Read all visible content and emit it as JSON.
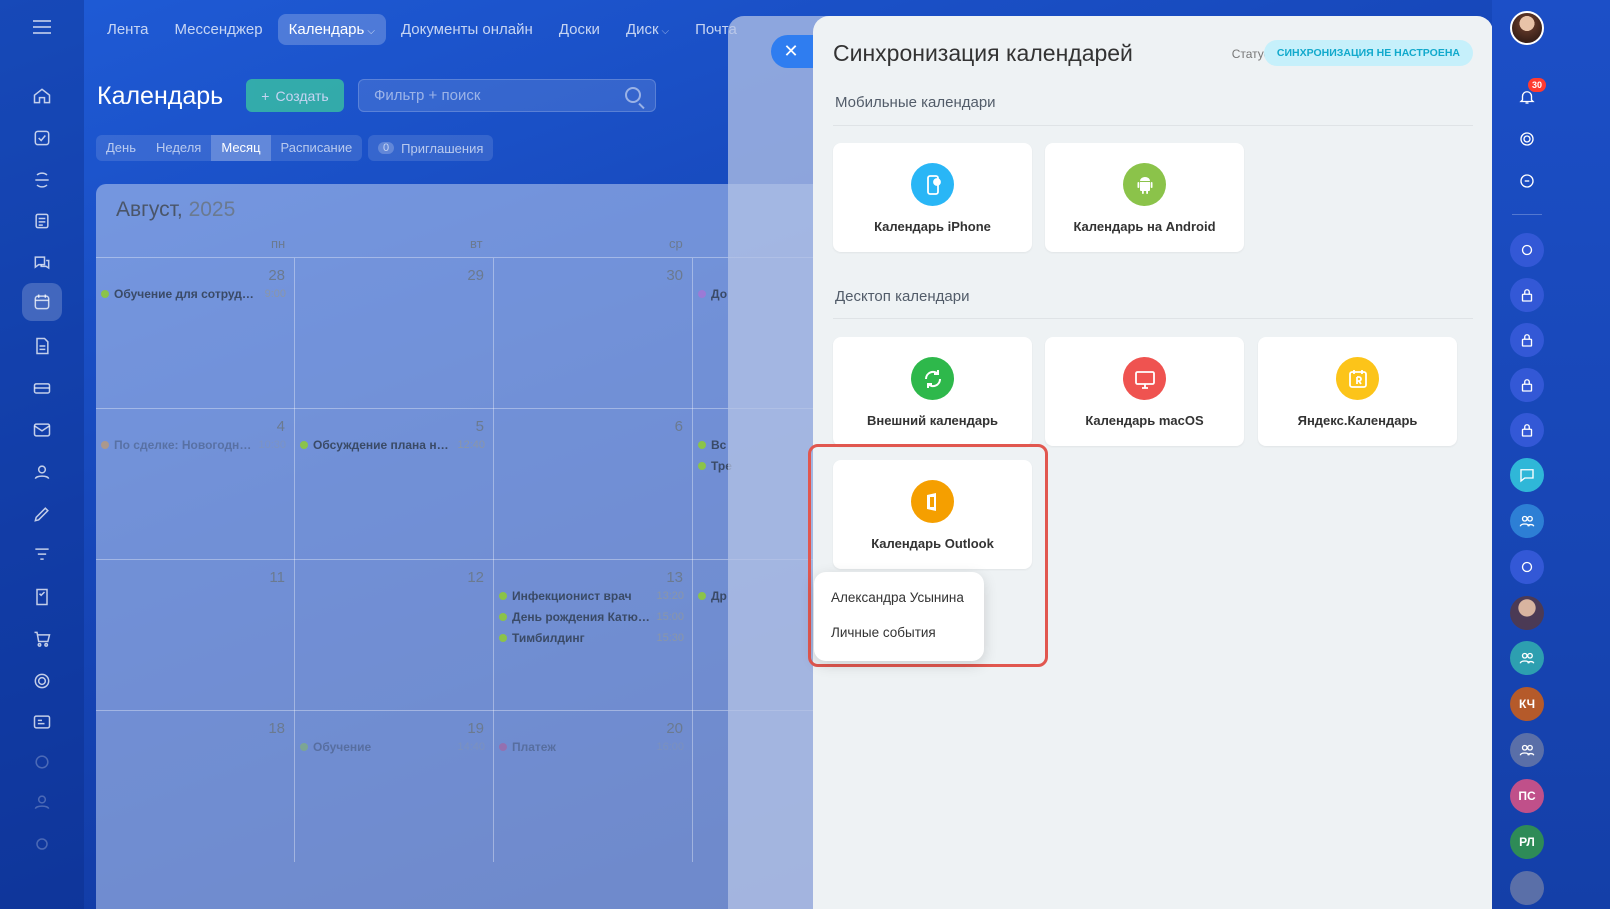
{
  "top_nav": {
    "items": [
      {
        "label": "Лента",
        "caret": false,
        "active": false
      },
      {
        "label": "Мессенджер",
        "caret": false,
        "active": false
      },
      {
        "label": "Календарь",
        "caret": true,
        "active": true
      },
      {
        "label": "Документы онлайн",
        "caret": false,
        "active": false
      },
      {
        "label": "Доски",
        "caret": false,
        "active": false
      },
      {
        "label": "Диск",
        "caret": true,
        "active": false
      },
      {
        "label": "Почта",
        "caret": false,
        "active": false
      }
    ]
  },
  "calendar": {
    "title": "Календарь",
    "create_label": "Создать",
    "search_placeholder": "Фильтр + поиск",
    "view_tabs": [
      "День",
      "Неделя",
      "Месяц",
      "Расписание"
    ],
    "active_view": "Месяц",
    "invites_count": "0",
    "invites_label": "Приглашения",
    "month": "Август,",
    "year": "2025",
    "weekdays": [
      "пн",
      "вт",
      "ср"
    ],
    "weeks": [
      {
        "days": [
          {
            "num": "28",
            "events": [
              {
                "name": "Обучение для сотрудник…",
                "time": "9:00",
                "color": "#8bc34a",
                "faded": false
              }
            ]
          },
          {
            "num": "29",
            "events": []
          },
          {
            "num": "30",
            "events": []
          },
          {
            "num": "",
            "events": [
              {
                "name": "До",
                "time": "",
                "color": "#9c7ad6",
                "faded": false
              }
            ]
          }
        ]
      },
      {
        "days": [
          {
            "num": "4",
            "events": [
              {
                "name": "По сделке: Новогодний …",
                "time": "10:30",
                "color": "#f0a030",
                "faded": true
              }
            ]
          },
          {
            "num": "5",
            "events": [
              {
                "name": "Обсуждение плана на п…",
                "time": "12:40",
                "color": "#8bc34a",
                "faded": false
              }
            ]
          },
          {
            "num": "6",
            "events": []
          },
          {
            "num": "",
            "events": [
              {
                "name": "Вс",
                "time": "",
                "color": "#8bc34a",
                "faded": false
              },
              {
                "name": "Тре",
                "time": "",
                "color": "#8bc34a",
                "faded": false
              }
            ]
          }
        ]
      },
      {
        "days": [
          {
            "num": "11",
            "events": []
          },
          {
            "num": "12",
            "events": []
          },
          {
            "num": "13",
            "events": [
              {
                "name": "Инфекционист врач",
                "time": "13:20",
                "color": "#8bc34a",
                "faded": false
              },
              {
                "name": "День рождения Катюш…",
                "time": "15:00",
                "color": "#8bc34a",
                "faded": false
              },
              {
                "name": "Тимбилдинг",
                "time": "15:30",
                "color": "#8bc34a",
                "faded": false
              }
            ]
          },
          {
            "num": "",
            "events": [
              {
                "name": "Др",
                "time": "",
                "color": "#8bc34a",
                "faded": false
              }
            ]
          }
        ]
      },
      {
        "days": [
          {
            "num": "18",
            "events": []
          },
          {
            "num": "19",
            "events": [
              {
                "name": "Обучение",
                "time": "14:40",
                "color": "#8bc34a",
                "faded": true
              }
            ]
          },
          {
            "num": "20",
            "events": [
              {
                "name": "Платеж",
                "time": "16:00",
                "color": "#c0508a",
                "faded": true
              }
            ]
          },
          {
            "num": "",
            "events": []
          }
        ]
      }
    ]
  },
  "sync_panel": {
    "title": "Синхронизация календарей",
    "status_label": "Статус:",
    "status_value": "СИНХРОНИЗАЦИЯ НЕ НАСТРОЕНА",
    "mobile_section": "Мобильные календари",
    "desktop_section": "Десктоп календари",
    "mobile_cards": [
      {
        "label": "Календарь iPhone",
        "icon": "iphone-icon",
        "color": "#29b6f6"
      },
      {
        "label": "Календарь на Android",
        "icon": "android-icon",
        "color": "#8bc34a"
      }
    ],
    "desktop_cards": [
      {
        "label": "Внешний календарь",
        "icon": "external-calendar-icon",
        "color": "#2eb84b"
      },
      {
        "label": "Календарь macOS",
        "icon": "macos-icon",
        "color": "#ef5350"
      },
      {
        "label": "Яндекс.Календарь",
        "icon": "yandex-calendar-icon",
        "color": "#fcc419"
      },
      {
        "label": "Календарь Outlook",
        "icon": "outlook-icon",
        "color": "#f59f00"
      }
    ],
    "popup_items": [
      "Александра Усынина",
      "Личные события"
    ]
  },
  "right_rail": {
    "notification_count": "30",
    "initials": [
      "КЧ",
      "ПС",
      "РЛ"
    ],
    "colors": {
      "kc": "#b55a2a",
      "ps": "#c0508a",
      "rl": "#2e8b57",
      "lock": "#3358d6",
      "group": "#2d7fd5"
    }
  },
  "colors": {
    "accent": "#2f7df0",
    "highlight": "#e1574f",
    "status_bg": "#c6f0fb",
    "status_text": "#11a9cc"
  }
}
